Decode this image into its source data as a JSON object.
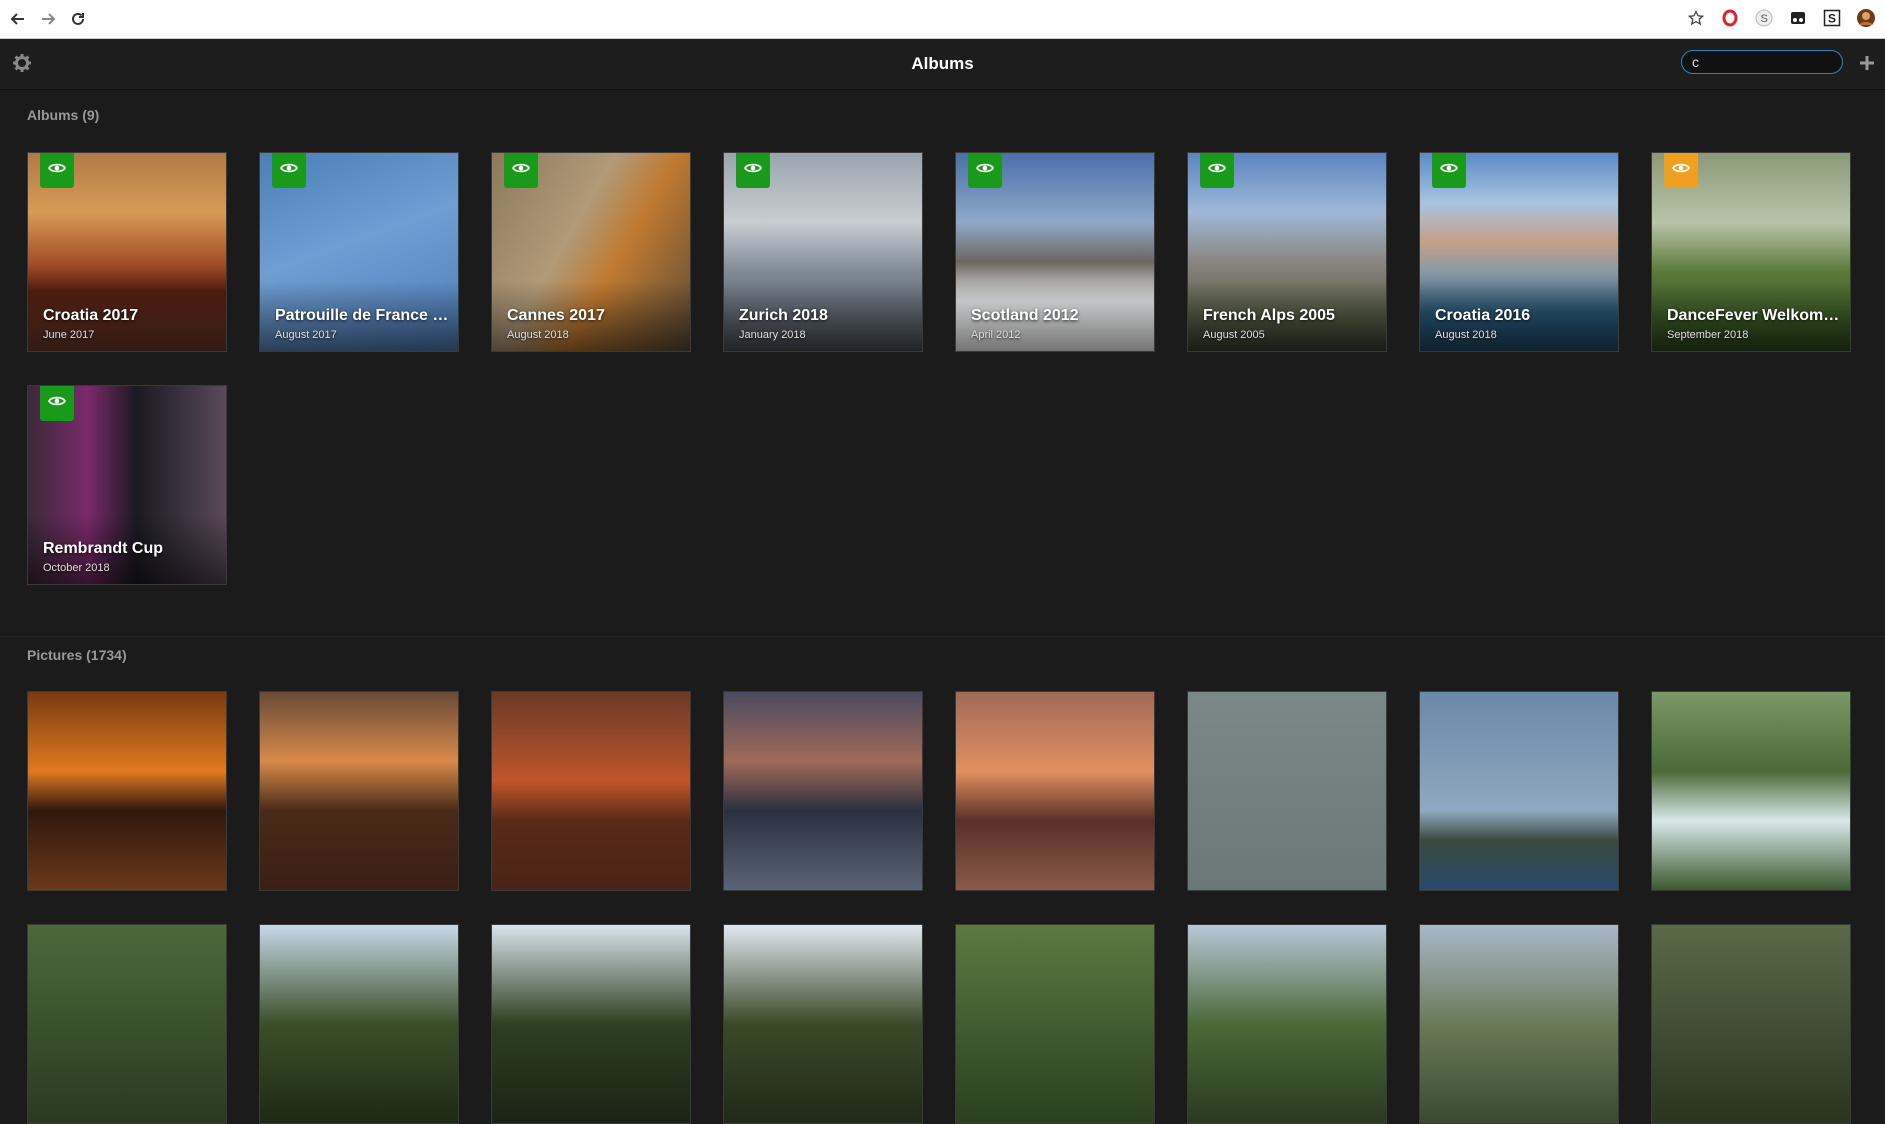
{
  "app": {
    "title": "Albums",
    "search_value": "c"
  },
  "albums_section": {
    "label": "Albums (9)"
  },
  "pictures_section": {
    "label": "Pictures (1734)"
  },
  "colors": {
    "badge_public": "#1a9a1a",
    "badge_hidden": "#f0a020",
    "search_border": "#2e86c9"
  },
  "albums": [
    {
      "title": "Croatia 2017",
      "date": "June 2017",
      "badge": "public",
      "bg": "linear-gradient(180deg,#b07a48 0%,#d69b55 30%,#a6502a 55%,#521d10 70%,#6d3a28 100%)"
    },
    {
      "title": "Patrouille de France …",
      "date": "August 2017",
      "badge": "public",
      "bg": "linear-gradient(160deg,#4b7fb8 0%,#6e9ed2 45%,#4d7cb5 100%)"
    },
    {
      "title": "Cannes 2017",
      "date": "August 2018",
      "badge": "public",
      "bg": "linear-gradient(120deg,#8c7a5a 0%,#b09a78 40%,#c07a30 60%,#5a4a38 100%)"
    },
    {
      "title": "Zurich 2018",
      "date": "January 2018",
      "badge": "public",
      "bg": "linear-gradient(180deg,#9aa4ae 0%,#c9cdd1 35%,#7e8a96 60%,#4a5058 100%)"
    },
    {
      "title": "Scotland 2012",
      "date": "April 2012",
      "badge": "public",
      "bg": "linear-gradient(180deg,#4a6fa8 0%,#8fa8c8 35%,#6d6660 55%,#e8eaec 75%,#ffffff 100%)"
    },
    {
      "title": "French Alps 2005",
      "date": "August 2005",
      "badge": "public",
      "bg": "linear-gradient(180deg,#5b84c0 0%,#9fb8d8 30%,#8a8680 55%,#5a6048 80%,#3a4030 100%)"
    },
    {
      "title": "Croatia 2016",
      "date": "August 2018",
      "badge": "public",
      "bg": "linear-gradient(180deg,#5a8ac8 0%,#a8c4e0 25%,#c4a088 45%,#8a9aa4 60%,#2a5a78 80%,#1e4a66 100%)"
    },
    {
      "title": "DanceFever Welkom…",
      "date": "September 2018",
      "badge": "hidden",
      "bg": "linear-gradient(180deg,#8a9a78 0%,#b8c4a8 35%,#5a7a3a 60%,#2a4a1a 100%)"
    },
    {
      "title": "Rembrandt Cup",
      "date": "October 2018",
      "badge": "public",
      "bg": "linear-gradient(90deg,#3a2a38 0%,#7a2a6a 30%,#1a1a22 55%,#5a4a5a 100%)"
    }
  ],
  "pictures": [
    {
      "bg": "linear-gradient(180deg,#7a3a10 0%,#e07a20 40%,#301810 60%,#6a3a18 100%)"
    },
    {
      "bg": "linear-gradient(180deg,#6a4a38 0%,#d88a48 35%,#4a2a18 60%,#3a2014 100%)"
    },
    {
      "bg": "linear-gradient(180deg,#6a3a28 0%,#c0552a 45%,#5a2a18 65%,#4a2418 100%)"
    },
    {
      "bg": "linear-gradient(180deg,#4a4a60 0%,#a06a58 35%,#2a3040 60%,#5a6478 100%)"
    },
    {
      "bg": "linear-gradient(180deg,#a06a58 0%,#e09060 40%,#5a3028 65%,#8a5a4a 100%)"
    },
    {
      "bg": "linear-gradient(180deg,#7a8888 0%,#6a7878 100%)"
    },
    {
      "bg": "linear-gradient(180deg,#6a88a8 0%,#90a8c0 60%,#3a4a40 75%,#2a4a6a 100%)"
    },
    {
      "bg": "linear-gradient(180deg,#7a9868 0%,#4a6a38 40%,#d8e8e8 65%,#3a5a30 100%)"
    },
    {
      "bg": "linear-gradient(180deg,#4a6a3a 0%,#2a3a20 100%)"
    },
    {
      "bg": "linear-gradient(180deg,#c8d8e8 0%,#3a5028 50%,#1e2a14 100%)"
    },
    {
      "bg": "linear-gradient(180deg,#d8e4ec 0%,#2e4020 50%,#1a2414 100%)"
    },
    {
      "bg": "linear-gradient(180deg,#e0e8f0 0%,#3a4a28 50%,#202a18 100%)"
    },
    {
      "bg": "linear-gradient(180deg,#5a7a40 0%,#2a4020 100%)"
    },
    {
      "bg": "linear-gradient(180deg,#b8c8d8 0%,#4a6a38 50%,#2a3a20 100%)"
    },
    {
      "bg": "linear-gradient(180deg,#a8b8c8 0%,#6a7a58 50%,#3a4a30 100%)"
    },
    {
      "bg": "linear-gradient(180deg,#5a6a48 0%,#2a3420 100%)"
    }
  ]
}
